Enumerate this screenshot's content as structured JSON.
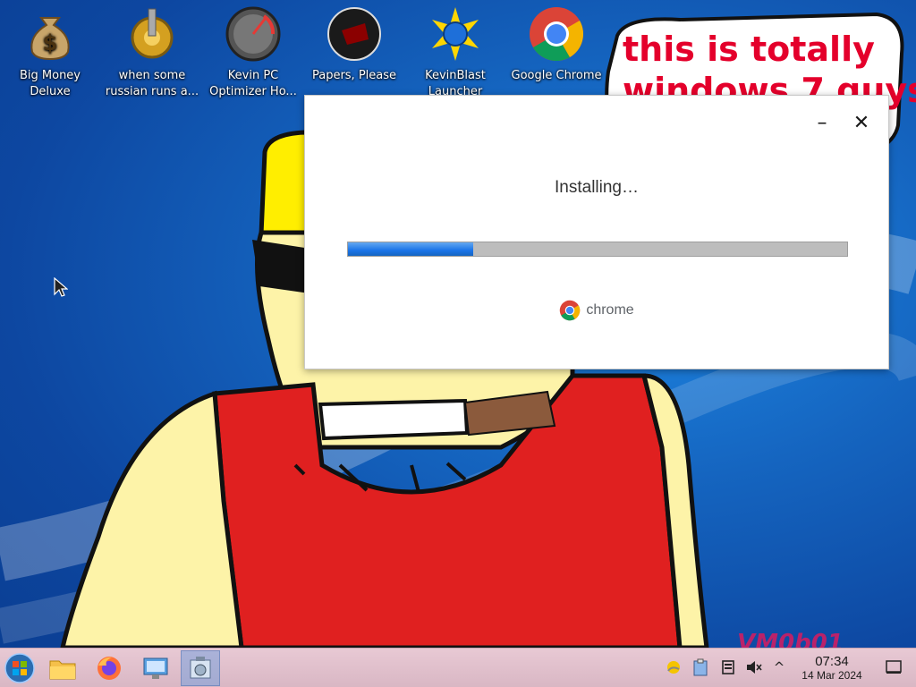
{
  "desktop": {
    "icons": [
      {
        "label": "Big Money Deluxe",
        "line1": "Big Money",
        "line2": "Deluxe",
        "icon": "money-bag-icon"
      },
      {
        "label": "when some russian runs a...",
        "line1": "when some",
        "line2": "russian runs a...",
        "icon": "gear-icon"
      },
      {
        "label": "Kevin PC Optimizer Ho...",
        "line1": "Kevin PC",
        "line2": "Optimizer Ho...",
        "icon": "speedometer-icon"
      },
      {
        "label": "Papers, Please",
        "line1": "Papers, Please",
        "line2": "",
        "icon": "papers-please-icon"
      },
      {
        "label": "KevinBlast Launcher",
        "line1": "KevinBlast",
        "line2": "Launcher",
        "icon": "kevinblast-icon"
      },
      {
        "label": "Google Chrome",
        "line1": "Google Chrome",
        "line2": "",
        "icon": "chrome-icon"
      }
    ],
    "bubble": {
      "line1": "this is totally",
      "line2": "windows 7 guys"
    },
    "watermark": "VM0b01"
  },
  "installer": {
    "status": "Installing…",
    "progress_percent": 25,
    "brand": "chrome",
    "minimize_symbol": "–",
    "close_symbol": "✕"
  },
  "taskbar": {
    "clock_time": "07:34",
    "clock_date": "14 Mar 2024",
    "tray_expand_symbol": "^"
  },
  "colors": {
    "progress": "#1a73e8",
    "bubble_text": "#e4002b",
    "taskbar": "#dcbcc8"
  }
}
